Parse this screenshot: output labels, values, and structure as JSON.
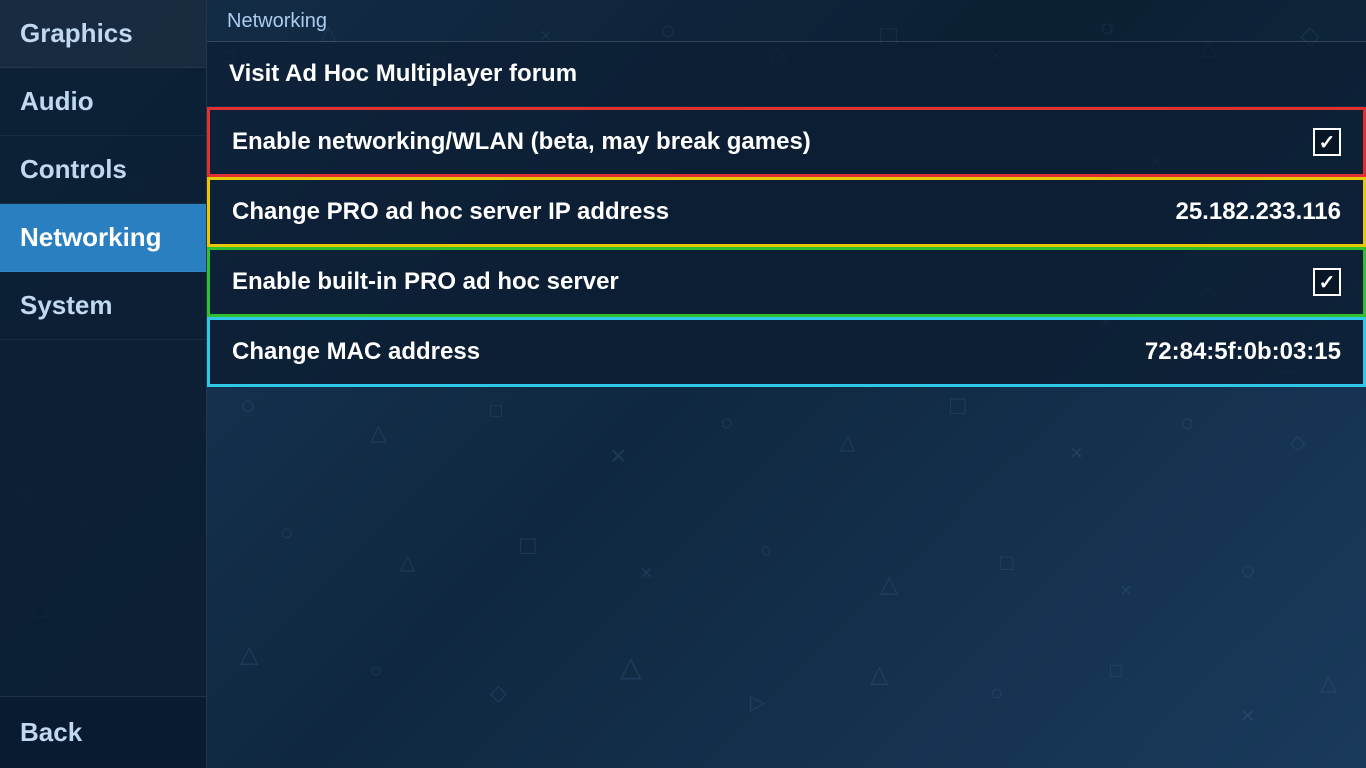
{
  "sidebar": {
    "items": [
      {
        "label": "Graphics",
        "active": false
      },
      {
        "label": "Audio",
        "active": false
      },
      {
        "label": "Controls",
        "active": false
      },
      {
        "label": "Networking",
        "active": true
      },
      {
        "label": "System",
        "active": false
      }
    ],
    "back_label": "Back"
  },
  "main": {
    "section_title": "Networking",
    "menu_items": [
      {
        "label": "Visit Ad Hoc Multiplayer forum",
        "value": "",
        "border": "none",
        "has_checkbox": false,
        "checkbox_checked": false
      },
      {
        "label": "Enable networking/WLAN (beta, may break games)",
        "value": "",
        "border": "red",
        "has_checkbox": true,
        "checkbox_checked": true
      },
      {
        "label": "Change PRO ad hoc server IP address",
        "value": "25.182.233.116",
        "border": "yellow",
        "has_checkbox": false,
        "checkbox_checked": false
      },
      {
        "label": "Enable built-in PRO ad hoc server",
        "value": "",
        "border": "green",
        "has_checkbox": true,
        "checkbox_checked": true
      },
      {
        "label": "Change MAC address",
        "value": "72:84:5f:0b:03:15",
        "border": "cyan",
        "has_checkbox": false,
        "checkbox_checked": false
      }
    ]
  },
  "bg_symbols": [
    "○",
    "△",
    "□",
    "×",
    "○",
    "△",
    "□",
    "×",
    "○",
    "△",
    "□",
    "×",
    "◇",
    "▷",
    "▽",
    "◁"
  ]
}
